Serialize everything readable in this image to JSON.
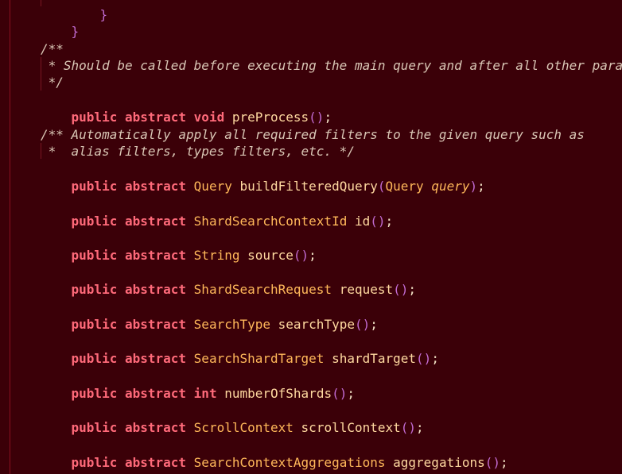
{
  "code": {
    "top_brace_partial": "}",
    "closing_brace": "}",
    "doc1": {
      "open": "/**",
      "body": " * Should be called before executing the main query and after all other para",
      "close": " */"
    },
    "decl_preprocess": {
      "mod1": "public",
      "mod2": "abstract",
      "type": "void",
      "name": "preProcess",
      "parens": "()",
      "semi": ";"
    },
    "doc2": {
      "line1": "/** Automatically apply all required filters to the given query such as",
      "line2": " *  alias filters, types filters, etc. */"
    },
    "decl_buildquery": {
      "mod1": "public",
      "mod2": "abstract",
      "type": "Query",
      "name": "buildFilteredQuery",
      "lparen": "(",
      "param_type": "Query",
      "param_name": "query",
      "rparen": ")",
      "semi": ";"
    },
    "decls": [
      {
        "mod1": "public",
        "mod2": "abstract",
        "type": "ShardSearchContextId",
        "name": "id",
        "parens": "()",
        "semi": ";"
      },
      {
        "mod1": "public",
        "mod2": "abstract",
        "type": "String",
        "name": "source",
        "parens": "()",
        "semi": ";"
      },
      {
        "mod1": "public",
        "mod2": "abstract",
        "type": "ShardSearchRequest",
        "name": "request",
        "parens": "()",
        "semi": ";"
      },
      {
        "mod1": "public",
        "mod2": "abstract",
        "type": "SearchType",
        "name": "searchType",
        "parens": "()",
        "semi": ";"
      },
      {
        "mod1": "public",
        "mod2": "abstract",
        "type": "SearchShardTarget",
        "name": "shardTarget",
        "parens": "()",
        "semi": ";"
      },
      {
        "mod1": "public",
        "mod2": "abstract",
        "type": "int",
        "name": "numberOfShards",
        "parens": "()",
        "semi": ";"
      },
      {
        "mod1": "public",
        "mod2": "abstract",
        "type": "ScrollContext",
        "name": "scrollContext",
        "parens": "()",
        "semi": ";"
      },
      {
        "mod1": "public",
        "mod2": "abstract",
        "type": "SearchContextAggregations",
        "name": "aggregations",
        "parens": "()",
        "semi": ";"
      }
    ]
  },
  "colors": {
    "background": "#3b0008",
    "keyword": "#ff6a7a",
    "type": "#ffb85a",
    "parens": "#c26bd2",
    "comment": "#d9c6b5"
  }
}
